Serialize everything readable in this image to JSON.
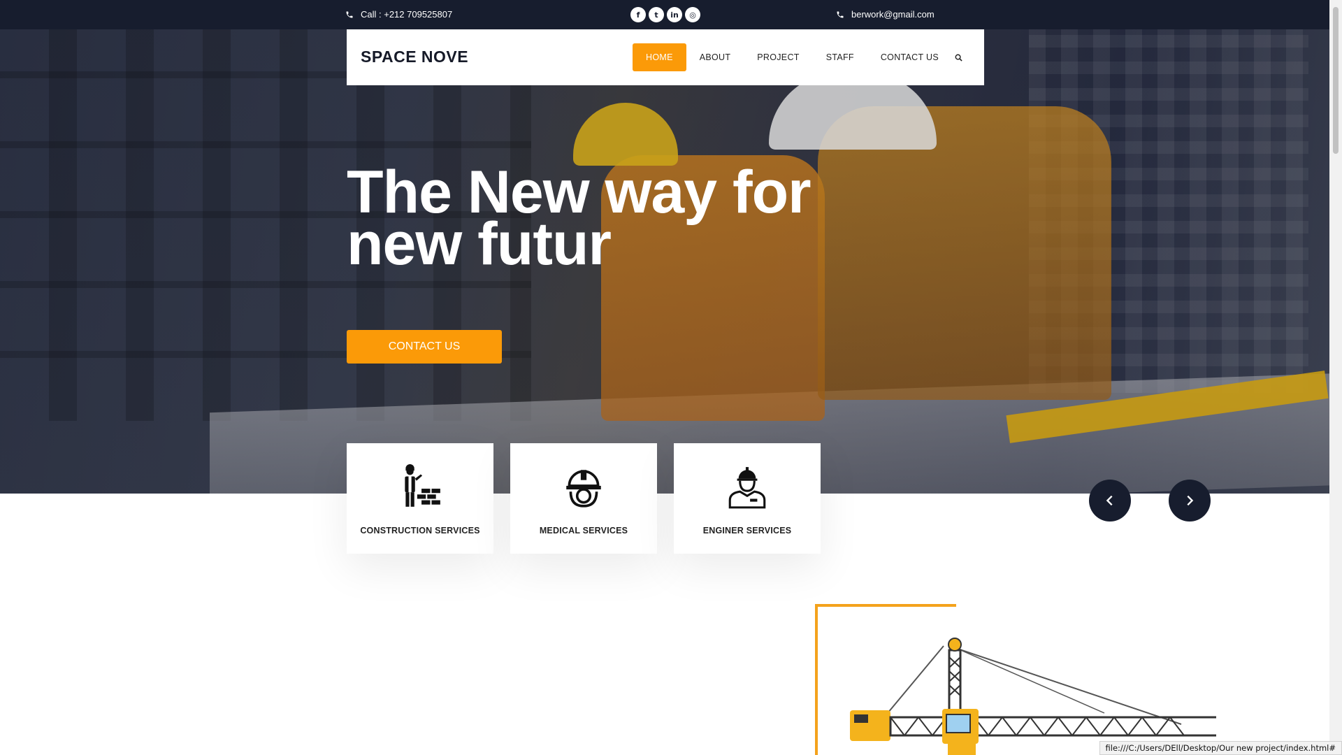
{
  "topbar": {
    "call": "Call : +212 709525807",
    "email": "berwork@gmail.com",
    "socials": [
      {
        "icon": "facebook-icon",
        "glyph": "f"
      },
      {
        "icon": "twitter-icon",
        "glyph": "t"
      },
      {
        "icon": "linkedin-icon",
        "glyph": "in"
      },
      {
        "icon": "instagram-icon",
        "glyph": "◎"
      }
    ]
  },
  "nav": {
    "brand": "SPACE NOVE",
    "items": [
      "HOME",
      "ABOUT",
      "PROJECT",
      "STAFF",
      "CONTACT US"
    ],
    "active_index": 0
  },
  "hero": {
    "headline": "The New way for new futur",
    "button": "CONTACT US"
  },
  "services": [
    {
      "label": "CONSTRUCTION SERVICES",
      "icon": "builder-bricks-icon"
    },
    {
      "label": "MEDICAL SERVICES",
      "icon": "helmet-gear-icon"
    },
    {
      "label": "ENGINER SERVICES",
      "icon": "engineer-icon"
    }
  ],
  "status_bar": "file:///C:/Users/DEll/Desktop/Our new project/index.html#",
  "colors": {
    "accent": "#fb9a08",
    "dark": "#171d2e"
  }
}
